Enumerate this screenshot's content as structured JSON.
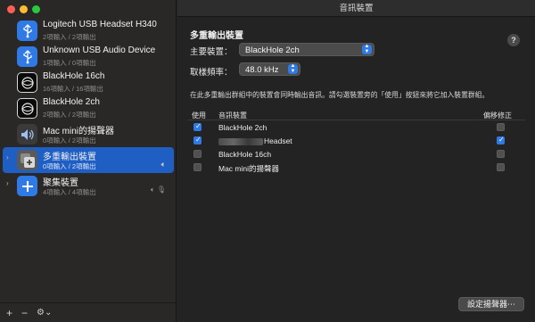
{
  "main": {
    "window_title": "音訊裝置",
    "section_title": "多重輸出裝置",
    "master_label": "主要裝置：",
    "master_value": "BlackHole 2ch",
    "rate_label": "取樣頻率：",
    "rate_value": "48.0 kHz",
    "description": "在此多重輸出群組中的裝置會同時輸出音訊。請勾選裝置旁的「使用」按鈕來將它加入裝置群組。",
    "help": "?",
    "config_button": "設定揚聲器⋯"
  },
  "table": {
    "col_use": "使用",
    "col_device": "音訊裝置",
    "col_drift": "偏移修正",
    "rows": [
      {
        "name": "BlackHole 2ch",
        "use": true,
        "drift": false
      },
      {
        "name": "Headset",
        "use": true,
        "drift": true
      },
      {
        "name": "BlackHole 16ch",
        "use": false,
        "drift": false
      },
      {
        "name": "Mac mini的揚聲器",
        "use": false,
        "drift": false
      }
    ]
  },
  "sidebar": {
    "devices": [
      {
        "name": "Logitech USB Headset H340",
        "sub": "2項輸入 / 2項輸出",
        "icon": "usb-icon"
      },
      {
        "name": "Unknown USB Audio Device",
        "sub": "1項輸入 / 0項輸出",
        "icon": "usb-icon"
      },
      {
        "name": "BlackHole 16ch",
        "sub": "16項輸入 / 16項輸出",
        "icon": "blackhole-icon"
      },
      {
        "name": "BlackHole 2ch",
        "sub": "2項輸入 / 2項輸出",
        "icon": "blackhole-icon"
      },
      {
        "name": "Mac mini的揚聲器",
        "sub": "0項輸入 / 2項輸出",
        "icon": "speaker-icon"
      },
      {
        "name": "多重輸出裝置",
        "sub": "0項輸入 / 2項輸出",
        "icon": "multi-output-icon",
        "selected": true
      },
      {
        "name": "聚集裝置",
        "sub": "4項輸入 / 4項輸出",
        "icon": "aggregate-icon"
      }
    ],
    "add": "+",
    "remove": "−",
    "gear": "⚙"
  }
}
